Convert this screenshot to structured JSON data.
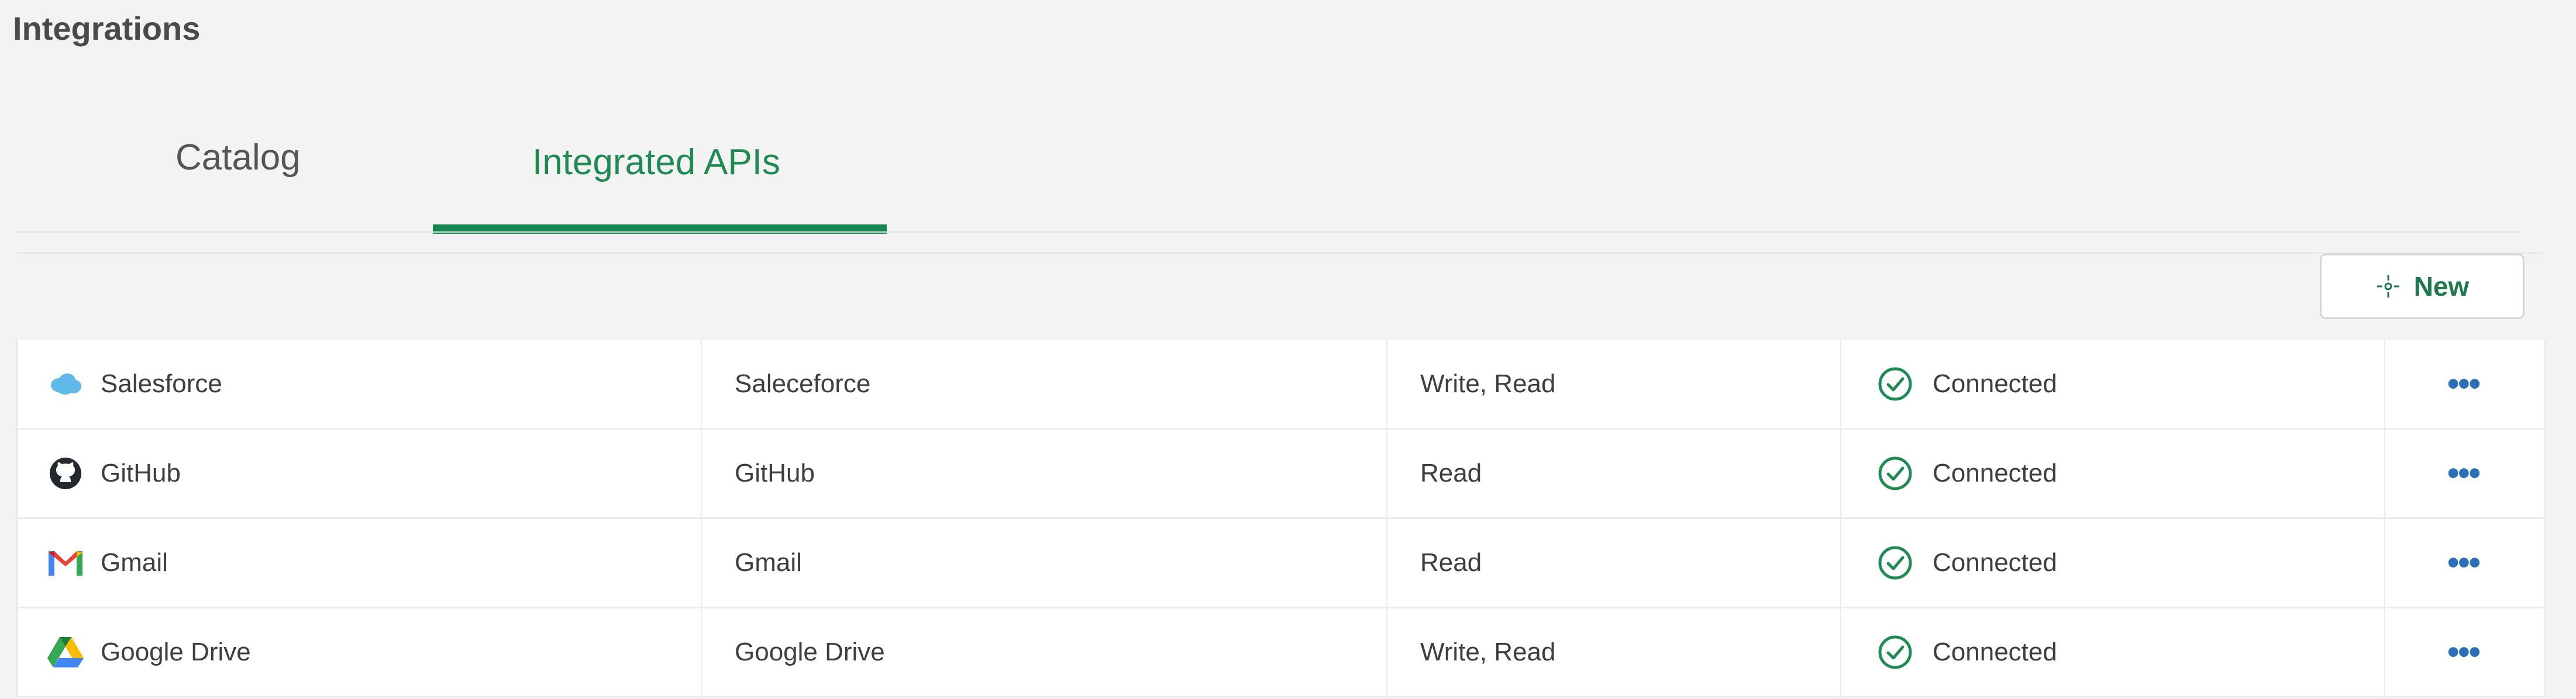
{
  "page": {
    "title": "Integrations"
  },
  "tabs": [
    {
      "label": "Catalog",
      "active": false
    },
    {
      "label": "Integrated APIs",
      "active": true
    }
  ],
  "toolbar": {
    "new_label": "New",
    "new_icon": "sparkle-icon"
  },
  "rows": [
    {
      "name": "Salesforce",
      "icon": "salesforce-icon",
      "api": "Saleceforce",
      "permissions": "Write, Read",
      "status": "Connected",
      "actions": "more-icon"
    },
    {
      "name": "GitHub",
      "icon": "github-icon",
      "api": "GitHub",
      "permissions": "Read",
      "status": "Connected",
      "actions": "more-icon"
    },
    {
      "name": "Gmail",
      "icon": "gmail-icon",
      "api": "Gmail",
      "permissions": "Read",
      "status": "Connected",
      "actions": "more-icon"
    },
    {
      "name": "Google Drive",
      "icon": "google-drive-icon",
      "api": "Google Drive",
      "permissions": "Write, Read",
      "status": "Connected",
      "actions": "more-icon"
    }
  ],
  "colors": {
    "accent": "#17854e",
    "status_ok": "#1f8a52",
    "more": "#2b6fb6"
  }
}
